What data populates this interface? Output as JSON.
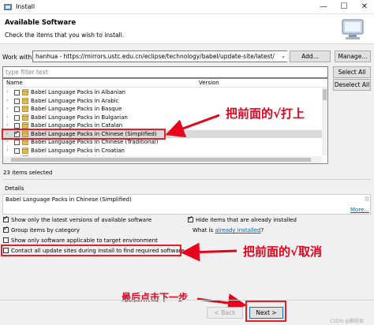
{
  "window": {
    "title": "Install",
    "min": "—",
    "max": "☐",
    "close": "✕"
  },
  "header": {
    "title": "Available Software",
    "subtitle": "Check the items that you wish to install."
  },
  "work_with": {
    "label": "Work with:",
    "value": "hanhua - https://mirrors.ustc.edu.cn/eclipse/technology/babel/update-site/latest/",
    "add": "Add...",
    "manage": "Manage..."
  },
  "filter": {
    "placeholder": "type filter text",
    "select_all": "Select All",
    "deselect_all": "Deselect All"
  },
  "columns": {
    "name": "Name",
    "version": "Version"
  },
  "items": [
    {
      "label": "Babel Language Packs in Albanian",
      "checked": false
    },
    {
      "label": "Babel Language Packs in Arabic",
      "checked": false
    },
    {
      "label": "Babel Language Packs in Basque",
      "checked": false
    },
    {
      "label": "Babel Language Packs in Bulgarian",
      "checked": false
    },
    {
      "label": "Babel Language Packs in Catalan",
      "checked": false
    },
    {
      "label": "Babel Language Packs in Chinese (Simplified)",
      "checked": true
    },
    {
      "label": "Babel Language Packs in Chinese (Traditional)",
      "checked": false
    },
    {
      "label": "Babel Language Packs in Croatian",
      "checked": false
    },
    {
      "label": "Babel Language Packs in Czech",
      "checked": false
    },
    {
      "label": "Babel Language Packs in Danish",
      "checked": false
    }
  ],
  "selected_count": "23 items selected",
  "details": {
    "label": "Details",
    "text": "Babel Language Packs in Chinese (Simplified)",
    "more": "More..."
  },
  "options": {
    "latest": "Show only the latest versions of available software",
    "hide_installed": "Hide items that are already installed",
    "group": "Group items by category",
    "what_is_prefix": "What is ",
    "already_installed": "already installed",
    "what_is_suffix": "?",
    "target_env": "Show only software applicable to target environment",
    "contact_all": "Contact all update sites during install to find required software"
  },
  "buttons": {
    "back": "< Back",
    "next": "Next >"
  },
  "annotations": {
    "check_front": "把前面的√打上",
    "uncheck_front": "把前面的√取消",
    "click_next": "最后点击下一步",
    "color": "#e8001c"
  },
  "watermark": "CSDN @鹏程君"
}
